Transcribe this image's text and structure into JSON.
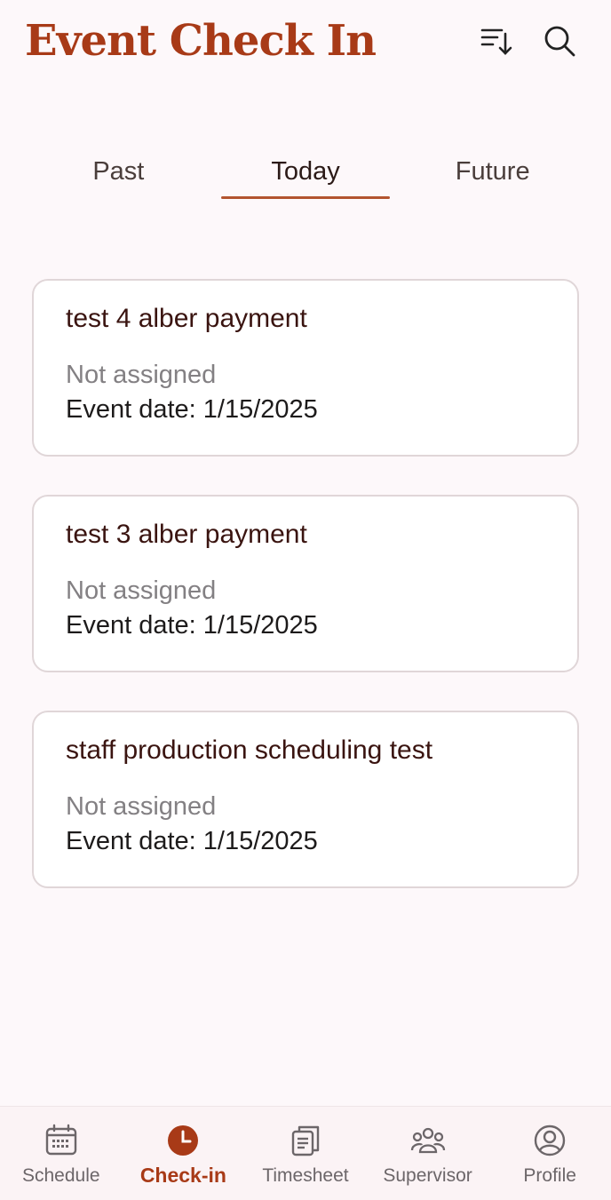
{
  "header": {
    "title": "Event Check In",
    "sort_icon": "sort-descending-icon",
    "search_icon": "search-icon"
  },
  "tabs": [
    {
      "label": "Past",
      "active": false
    },
    {
      "label": "Today",
      "active": true
    },
    {
      "label": "Future",
      "active": false
    }
  ],
  "events": [
    {
      "title": "test 4 alber payment",
      "status": "Not assigned",
      "date": "Event date: 1/15/2025"
    },
    {
      "title": "test 3 alber payment",
      "status": "Not assigned",
      "date": "Event date: 1/15/2025"
    },
    {
      "title": "staff production scheduling test",
      "status": "Not assigned",
      "date": "Event date: 1/15/2025"
    }
  ],
  "bottom_nav": [
    {
      "label": "Schedule",
      "icon": "calendar-icon",
      "active": false
    },
    {
      "label": "Check-in",
      "icon": "clock-icon",
      "active": true
    },
    {
      "label": "Timesheet",
      "icon": "clipboard-icon",
      "active": false
    },
    {
      "label": "Supervisor",
      "icon": "group-icon",
      "active": false
    },
    {
      "label": "Profile",
      "icon": "user-circle-icon",
      "active": false
    }
  ],
  "colors": {
    "accent": "#a83a17",
    "tab_underline": "#b3542f",
    "background": "#fdf8fa",
    "card_border": "#e0d6d8"
  }
}
